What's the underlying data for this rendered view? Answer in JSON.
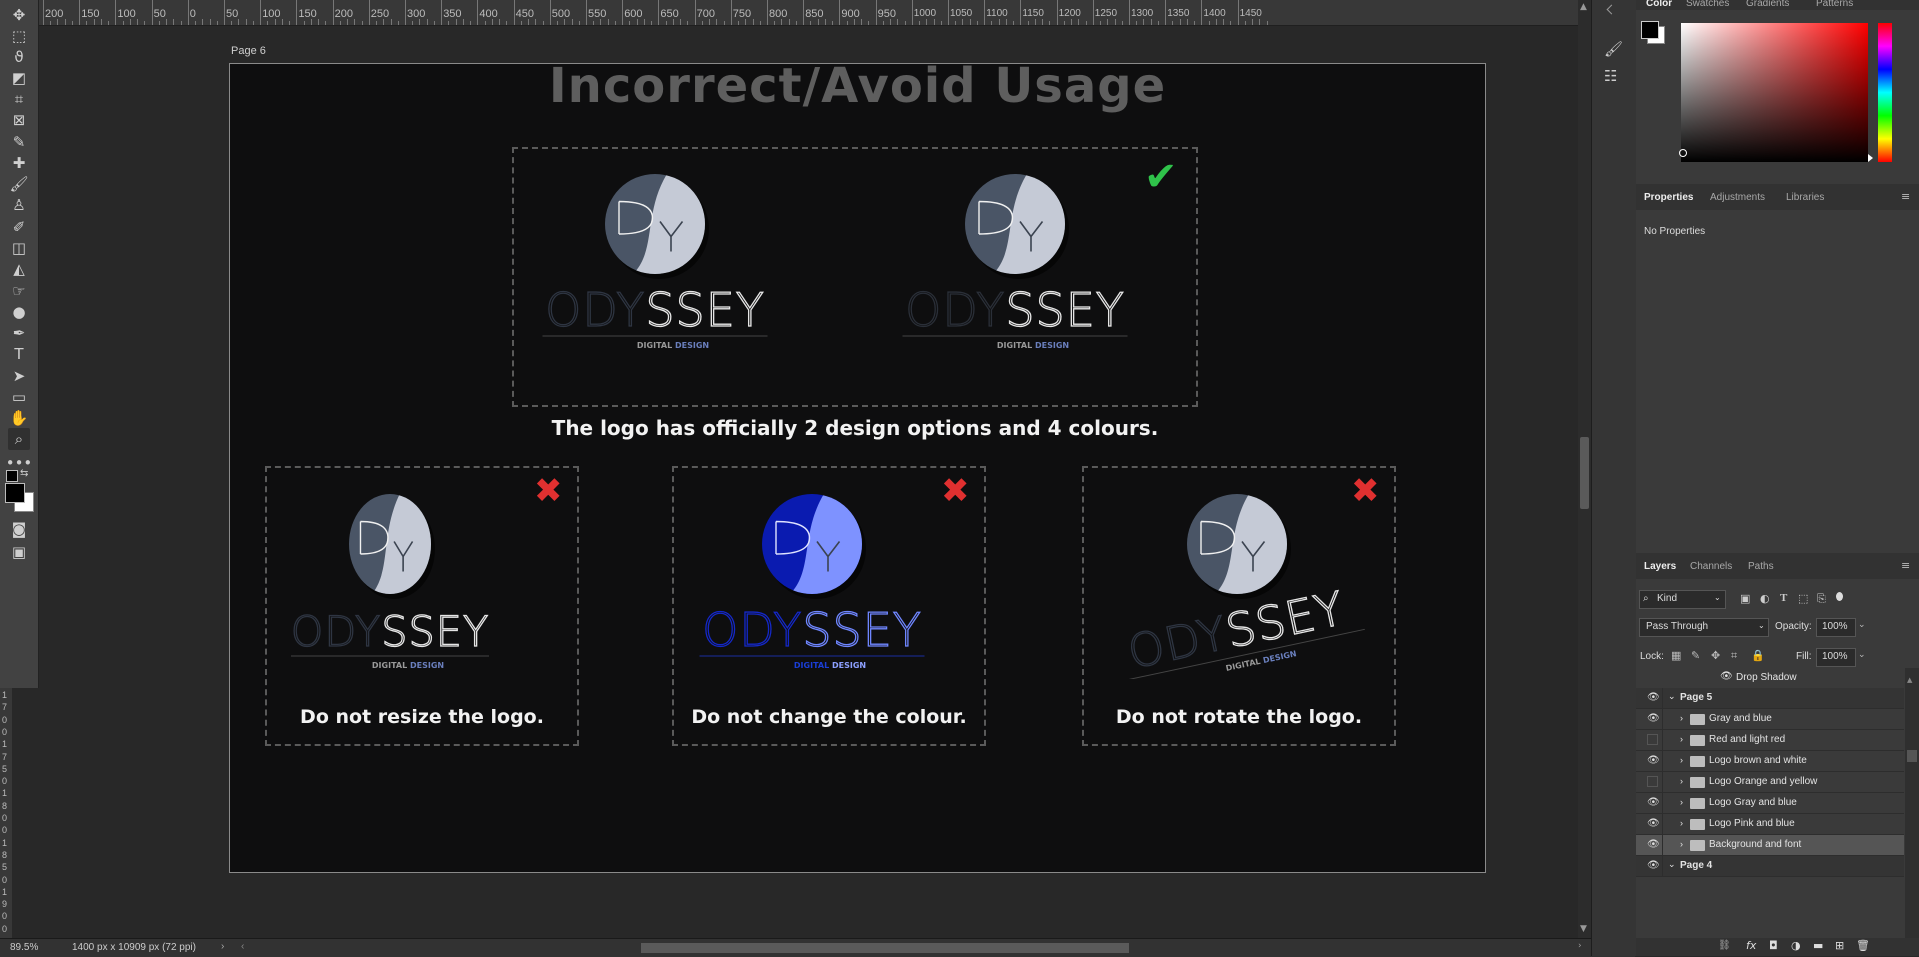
{
  "status": {
    "zoom": "89.5%",
    "doc_size": "1400 px x 10909 px (72 ppi)"
  },
  "ruler": {
    "labels": [
      "200",
      "150",
      "100",
      "50",
      "0",
      "50",
      "100",
      "150",
      "200",
      "250",
      "300",
      "350",
      "400",
      "450",
      "500",
      "550",
      "600",
      "650",
      "700",
      "750",
      "800",
      "850",
      "900",
      "950",
      "1000",
      "1050",
      "1100",
      "1150",
      "1200",
      "1250",
      "1300",
      "1350",
      "1400",
      "1450"
    ],
    "vertical_digits": [
      "1",
      "7",
      "0",
      "0",
      "1",
      "7",
      "5",
      "0",
      "1",
      "8",
      "0",
      "0",
      "1",
      "8",
      "5",
      "0",
      "1",
      "9",
      "0",
      "0"
    ]
  },
  "canvas": {
    "page_label": "Page 6",
    "heading": "Incorrect/Avoid Usage",
    "logo": {
      "letters": "ODYSSEY",
      "monogram": "DY",
      "tagline_a": "DIGITAL",
      "tagline_b": "DESIGN"
    },
    "caption_top": "The logo has officially 2 design options and 4 colours.",
    "captions": [
      "Do not resize the logo.",
      "Do not change the colour.",
      "Do not rotate the logo."
    ],
    "check_glyph": "✔",
    "x_glyph": "✖"
  },
  "panels": {
    "color_tabs": [
      "Color",
      "Swatches",
      "Gradients",
      "Patterns"
    ],
    "props_tabs": [
      "Properties",
      "Adjustments",
      "Libraries"
    ],
    "no_properties": "No Properties",
    "layers_tabs": [
      "Layers",
      "Channels",
      "Paths"
    ],
    "kind": "Kind",
    "blend_mode": "Pass Through",
    "opacity_label": "Opacity:",
    "opacity": "100%",
    "lock_label": "Lock:",
    "fill_label": "Fill:",
    "fill": "100%",
    "effect": "Drop Shadow",
    "layers": [
      {
        "name": "Page 5",
        "type": "group-top",
        "visible": true
      },
      {
        "name": "Gray and blue",
        "type": "folder",
        "visible": true
      },
      {
        "name": "Red and light red",
        "type": "folder",
        "visible": false
      },
      {
        "name": "Logo brown and white",
        "type": "folder",
        "visible": true
      },
      {
        "name": "Logo Orange and yellow",
        "type": "folder",
        "visible": false
      },
      {
        "name": "Logo Gray and blue",
        "type": "folder",
        "visible": true
      },
      {
        "name": "Logo Pink and blue",
        "type": "folder",
        "visible": true
      },
      {
        "name": "Background and font",
        "type": "folder",
        "visible": true,
        "selected": true
      },
      {
        "name": "Page 4",
        "type": "group-top",
        "visible": true
      }
    ]
  },
  "colors": {
    "accent_red": "#e03030",
    "accent_green": "#2fc24a",
    "logo_grey": "#4a5566",
    "logo_light": "#c5cad6",
    "blue_dark": "#0a1bb0",
    "blue_light": "#7e92ff"
  }
}
